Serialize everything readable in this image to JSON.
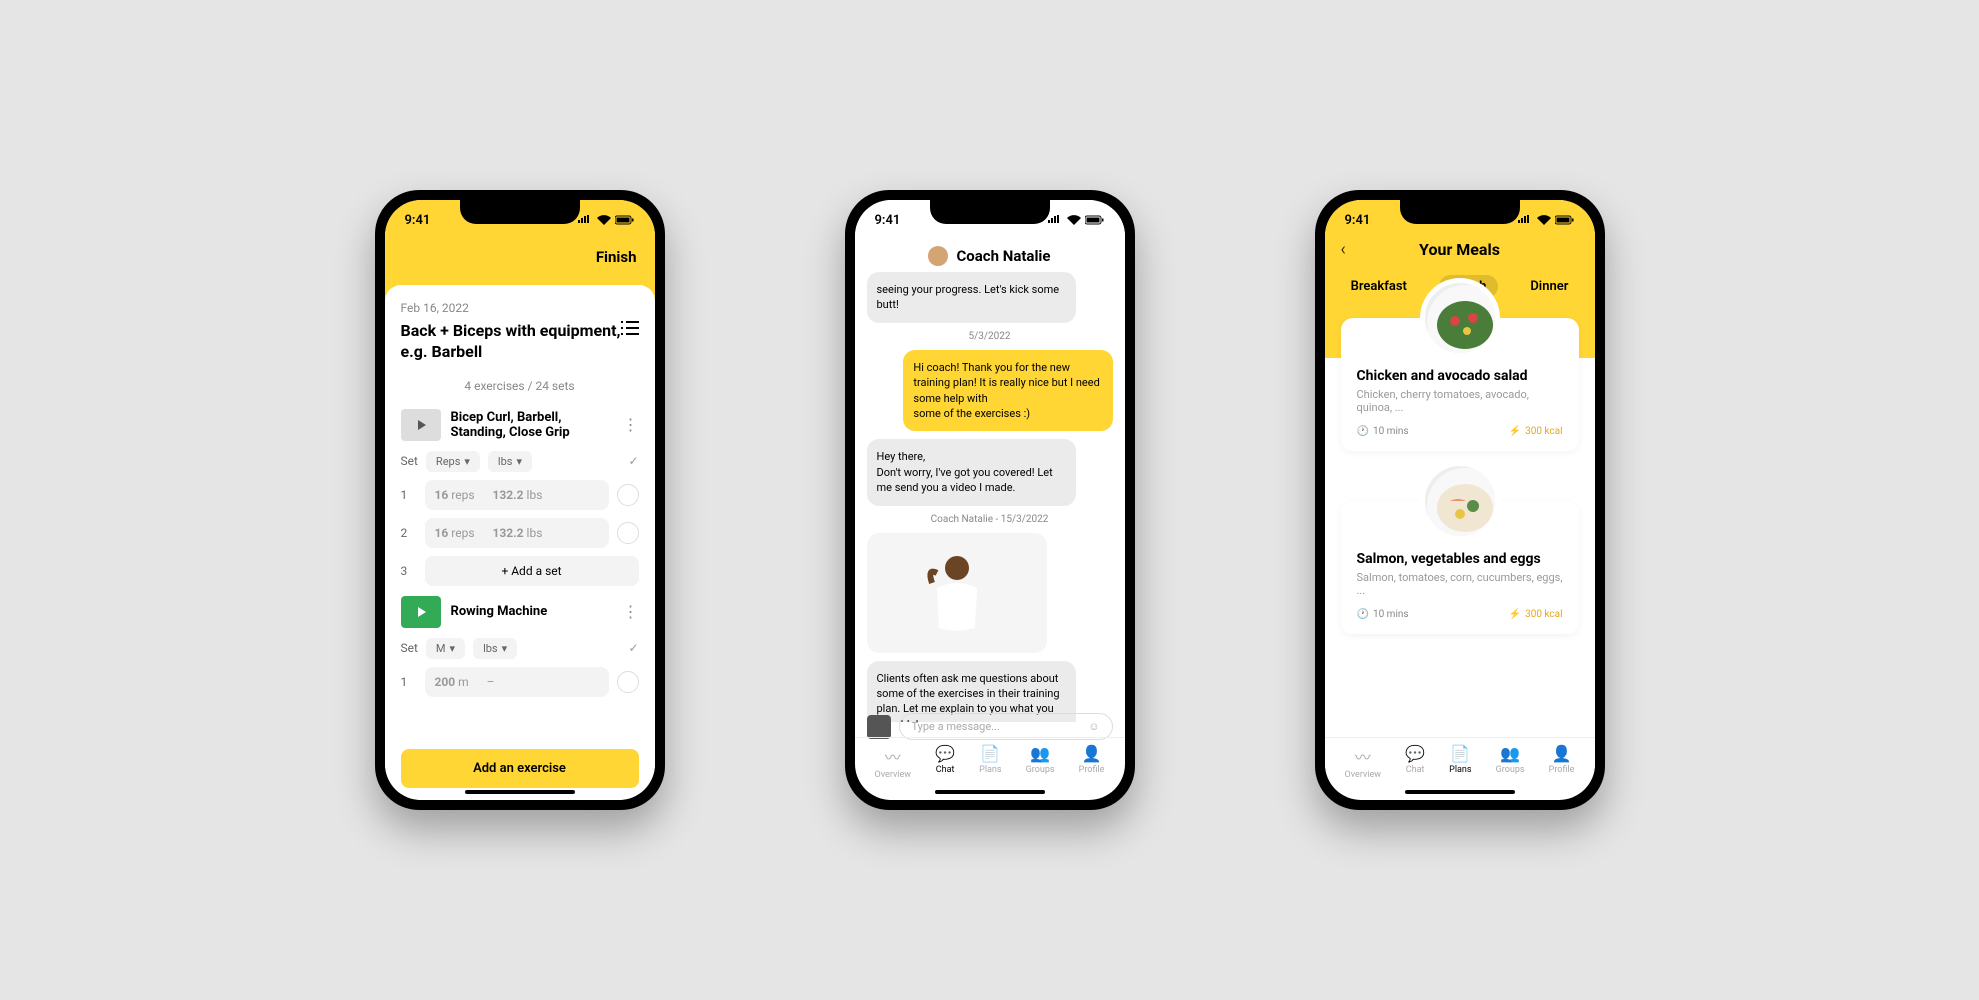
{
  "status_time": "9:41",
  "screen1": {
    "finish": "Finish",
    "date": "Feb 16, 2022",
    "title": "Back + Biceps with equipment, e.g. Barbell",
    "meta": "4 exercises / 24 sets",
    "exercises": [
      {
        "name": "Bicep Curl, Barbell, Standing, Close Grip"
      },
      {
        "name": "Rowing Machine"
      }
    ],
    "set_label": "Set",
    "reps_label": "Reps",
    "lbs_label": "lbs",
    "m_label": "M",
    "sets": [
      {
        "n": "1",
        "reps": "16",
        "reps_u": "reps",
        "w": "132.2",
        "w_u": "lbs"
      },
      {
        "n": "2",
        "reps": "16",
        "reps_u": "reps",
        "w": "132.2",
        "w_u": "lbs"
      }
    ],
    "set3": "3",
    "add_set": "+ Add a set",
    "row_set": {
      "n": "1",
      "v": "200",
      "u": "m",
      "dash": "–"
    },
    "add_exercise": "Add an exercise"
  },
  "screen2": {
    "coach_name": "Coach Natalie",
    "msg1": "seeing your progress. Let's kick some butt!",
    "date1": "5/3/2022",
    "msg2": "Hi coach! Thank you for the new training plan! It is really nice but I need some help with\nsome of the exercises :)",
    "msg3": "Hey there,\nDon't worry, I've got you covered! Let me send you a video I made.",
    "date2": "Coach Natalie - 15/3/2022",
    "msg4": "Clients often ask me questions about some of the exercises in their training plan. Let me explain to you what you should do.",
    "placeholder": "Type a message...",
    "nav": [
      "Overview",
      "Chat",
      "Plans",
      "Groups",
      "Profile"
    ]
  },
  "screen3": {
    "title": "Your Meals",
    "tabs": [
      "Breakfast",
      "Lunch",
      "Dinner"
    ],
    "meals": [
      {
        "name": "Chicken and avocado salad",
        "ing": "Chicken, cherry tomatoes, avocado, quinoa, ...",
        "time": "10 mins",
        "kcal": "300 kcal"
      },
      {
        "name": "Salmon, vegetables and eggs",
        "ing": "Salmon, tomatoes, corn, cucumbers, eggs, ...",
        "time": "10 mins",
        "kcal": "300 kcal"
      }
    ],
    "nav": [
      "Overview",
      "Chat",
      "Plans",
      "Groups",
      "Profile"
    ]
  }
}
